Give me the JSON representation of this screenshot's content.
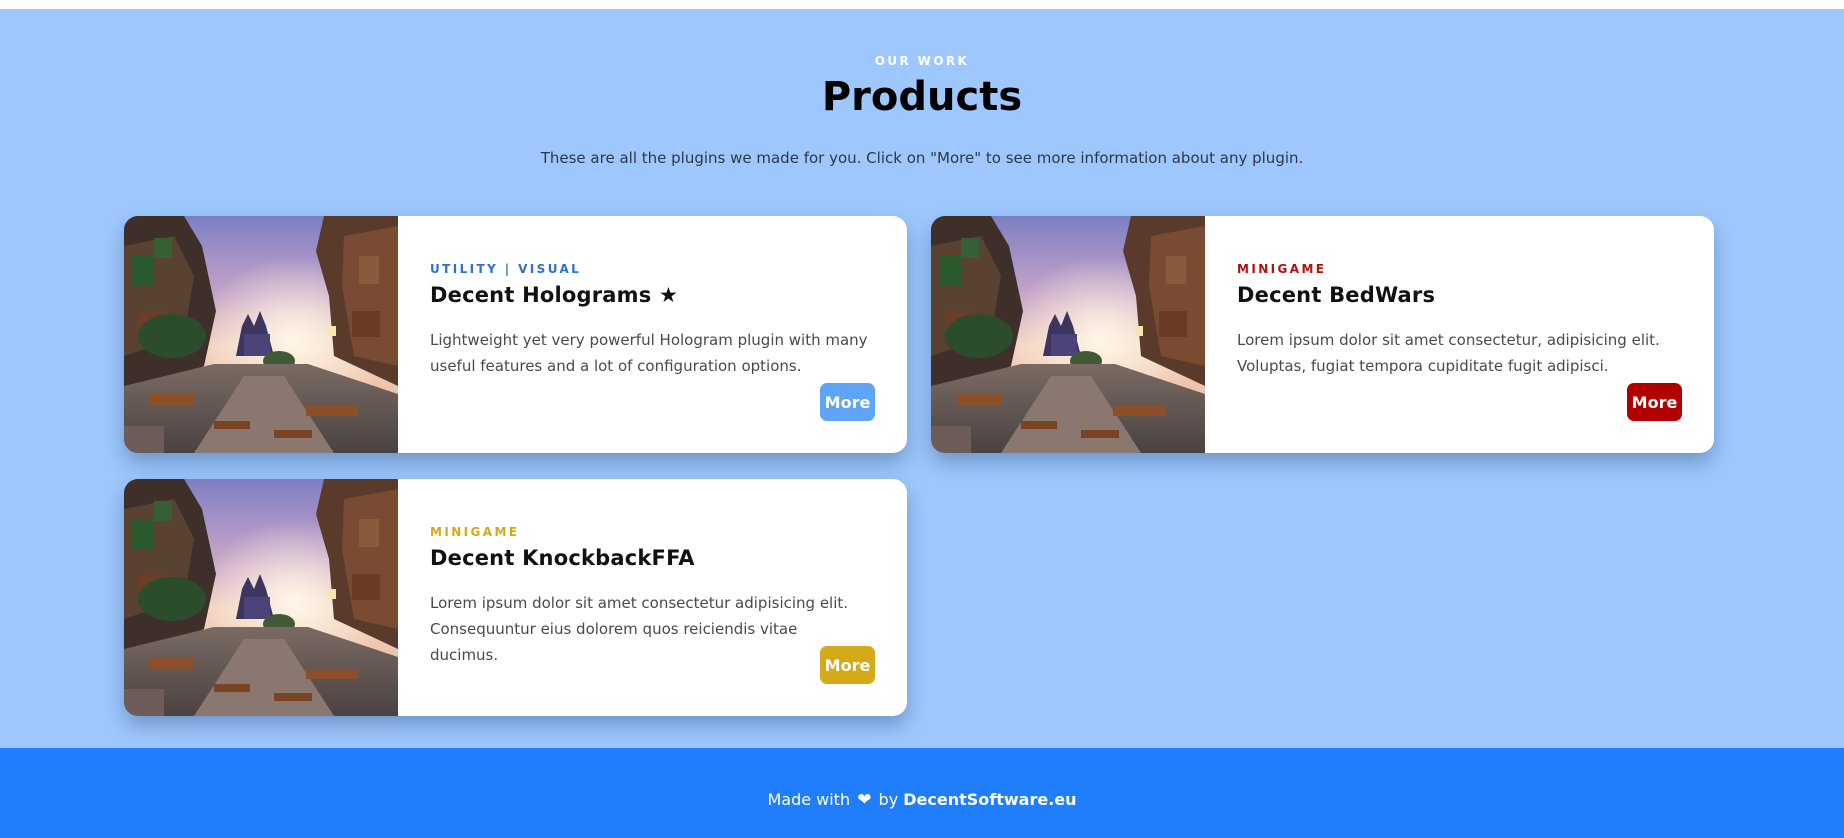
{
  "header": {
    "eyebrow": "OUR WORK",
    "title": "Products",
    "subtitle": "These are all the plugins we made for you. Click on \"More\" to see more information about any plugin."
  },
  "products": [
    {
      "tag": "UTILITY | VISUAL",
      "tag_color": "#2f6fd6",
      "title": "Decent Holograms ★",
      "description": "Lightweight yet very powerful Hologram plugin with many useful features and a lot of configuration options.",
      "button_label": "More",
      "button_color": "#60a4f8"
    },
    {
      "tag": "MINIGAME",
      "tag_color": "#b40f0f",
      "title": "Decent BedWars",
      "description": "Lorem ipsum dolor sit amet consectetur, adipisicing elit. Voluptas, fugiat tempora cupiditate fugit adipisci.",
      "button_label": "More",
      "button_color": "#b20000"
    },
    {
      "tag": "MINIGAME",
      "tag_color": "#d4a915",
      "title": "Decent KnockbackFFA",
      "description": "Lorem ipsum dolor sit amet consectetur adipisicing elit. Consequuntur eius dolorem quos reiciendis vitae ducimus.",
      "button_label": "More",
      "button_color": "#d4aa19"
    }
  ],
  "footer": {
    "prefix": "Made with",
    "heart_icon": "heart-icon",
    "by": "by",
    "link": "DecentSoftware.eu"
  },
  "colors": {
    "section_bg": "#9ec8fd",
    "footer_bg": "#207efc"
  }
}
